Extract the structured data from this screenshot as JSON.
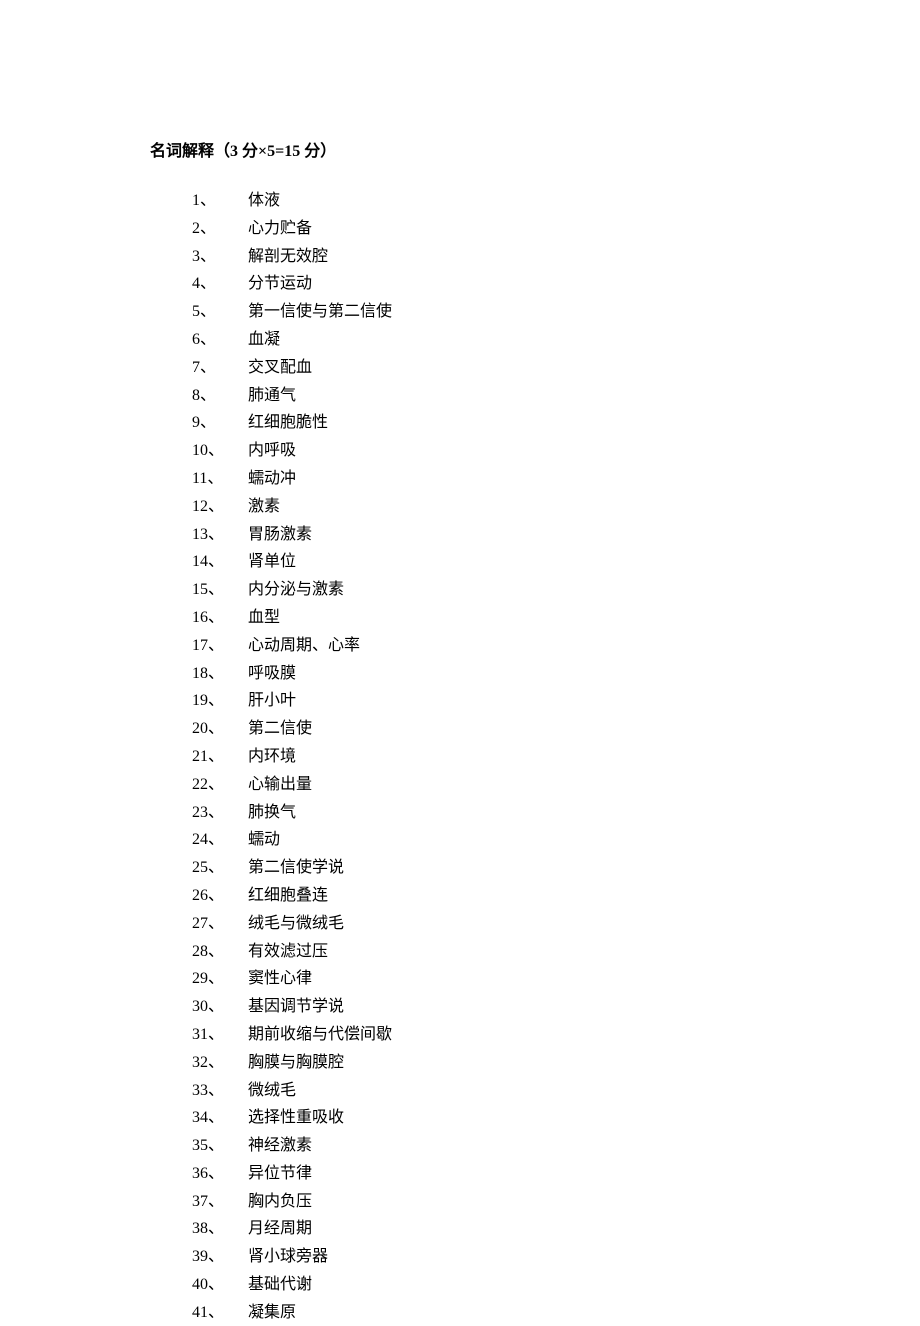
{
  "title": "名词解释（3 分×5=15 分）",
  "items": [
    {
      "num": "1",
      "text": "体液"
    },
    {
      "num": "2",
      "text": "心力贮备"
    },
    {
      "num": "3",
      "text": "解剖无效腔"
    },
    {
      "num": "4",
      "text": "分节运动"
    },
    {
      "num": "5",
      "text": "第一信使与第二信使"
    },
    {
      "num": "6",
      "text": "血凝"
    },
    {
      "num": "7",
      "text": "交叉配血"
    },
    {
      "num": "8",
      "text": "肺通气"
    },
    {
      "num": "9",
      "text": "红细胞脆性"
    },
    {
      "num": "10",
      "text": "内呼吸"
    },
    {
      "num": "11",
      "text": "蠕动冲"
    },
    {
      "num": "12",
      "text": "激素"
    },
    {
      "num": "13",
      "text": "胃肠激素"
    },
    {
      "num": "14",
      "text": "肾单位"
    },
    {
      "num": "15",
      "text": "内分泌与激素"
    },
    {
      "num": "16",
      "text": "血型"
    },
    {
      "num": "17",
      "text": "心动周期、心率"
    },
    {
      "num": "18",
      "text": "呼吸膜"
    },
    {
      "num": "19",
      "text": "肝小叶"
    },
    {
      "num": "20",
      "text": "第二信使"
    },
    {
      "num": "21",
      "text": "内环境"
    },
    {
      "num": "22",
      "text": "心输出量"
    },
    {
      "num": "23",
      "text": "肺换气"
    },
    {
      "num": "24",
      "text": "蠕动"
    },
    {
      "num": "25",
      "text": "第二信使学说"
    },
    {
      "num": "26",
      "text": "红细胞叠连"
    },
    {
      "num": "27",
      "text": "绒毛与微绒毛"
    },
    {
      "num": "28",
      "text": "有效滤过压"
    },
    {
      "num": "29",
      "text": "窦性心律"
    },
    {
      "num": "30",
      "text": "基因调节学说"
    },
    {
      "num": "31",
      "text": "期前收缩与代偿间歇"
    },
    {
      "num": "32",
      "text": "胸膜与胸膜腔"
    },
    {
      "num": "33",
      "text": "微绒毛"
    },
    {
      "num": "34",
      "text": "选择性重吸收"
    },
    {
      "num": "35",
      "text": "神经激素"
    },
    {
      "num": "36",
      "text": "异位节律"
    },
    {
      "num": "37",
      "text": "胸内负压"
    },
    {
      "num": "38",
      "text": "月经周期"
    },
    {
      "num": "39",
      "text": "肾小球旁器"
    },
    {
      "num": "40",
      "text": "基础代谢"
    },
    {
      "num": "41",
      "text": "凝集原"
    }
  ]
}
